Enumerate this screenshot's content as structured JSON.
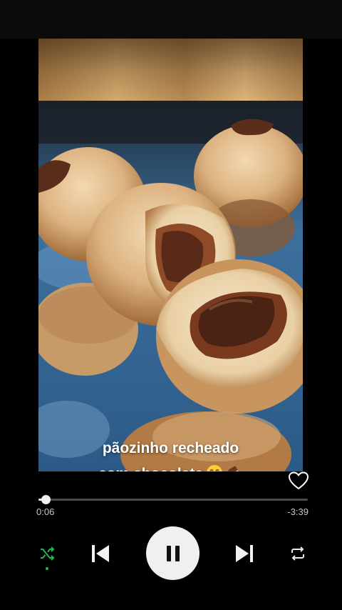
{
  "post": {
    "caption_line1": "pãozinho recheado",
    "caption_line2": "com chocolate"
  },
  "player": {
    "elapsed": "0:06",
    "remaining": "-3:39",
    "progress_fraction": 0.027,
    "is_playing": true,
    "shuffle_active": true,
    "liked": false
  },
  "icons": {
    "like": "heart-outline-icon",
    "shuffle": "shuffle-icon",
    "previous": "skip-previous-icon",
    "play_pause": "pause-icon",
    "next": "skip-next-icon",
    "repeat": "repeat-icon"
  },
  "colors": {
    "background": "#000000",
    "accent": "#1db954",
    "control": "#f0f0f0",
    "track": "#4a4a4a"
  }
}
